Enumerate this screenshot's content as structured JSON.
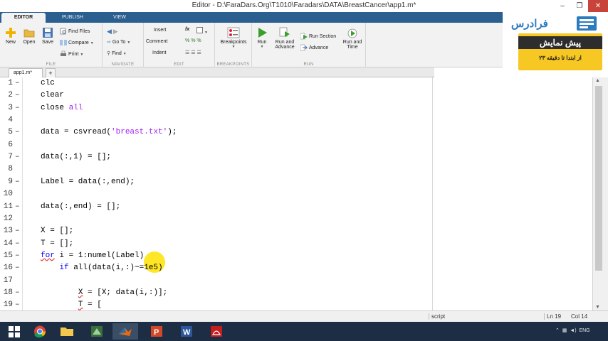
{
  "window": {
    "title": "Editor - D:\\FaraDars.Org\\T1010\\Faradars\\DATA\\BreastCancer\\app1.m*",
    "min": "–",
    "max": "❐",
    "close": "✕"
  },
  "tabs": [
    {
      "label": "EDITOR",
      "active": true
    },
    {
      "label": "PUBLISH",
      "active": false
    },
    {
      "label": "VIEW",
      "active": false
    }
  ],
  "ribbon": {
    "file": {
      "group": "FILE",
      "new": "New",
      "open": "Open",
      "save": "Save",
      "find_files": "Find Files",
      "compare": "Compare",
      "print": "Print"
    },
    "navigate": {
      "group": "NAVIGATE",
      "go_to": "Go To",
      "find": "Find"
    },
    "edit": {
      "group": "EDIT",
      "insert": "Insert",
      "fx": "fx",
      "comment": "Comment",
      "indent": "Indent"
    },
    "breakpoints": {
      "group": "BREAKPOINTS",
      "breakpoints": "Breakpoints"
    },
    "run": {
      "group": "RUN",
      "run": "Run",
      "run_and_advance": "Run and Advance",
      "run_section": "Run Section",
      "advance": "Advance",
      "run_and_time": "Run and Time"
    }
  },
  "ad": {
    "logo_text": "فرادرس",
    "line1": "پیش نمایش",
    "line2": "از ابتدا تا دقیقه ۲۳"
  },
  "file_tab": {
    "name": "app1.m*",
    "add": "+"
  },
  "code_lines": [
    {
      "n": "1",
      "text": "clc"
    },
    {
      "n": "2",
      "text": "clear"
    },
    {
      "n": "3",
      "text": "close all"
    },
    {
      "n": "4",
      "text": ""
    },
    {
      "n": "5",
      "text": "data = csvread('breast.txt');"
    },
    {
      "n": "6",
      "text": ""
    },
    {
      "n": "7",
      "text": "data(:,1) = [];"
    },
    {
      "n": "8",
      "text": ""
    },
    {
      "n": "9",
      "text": "Label = data(:,end);"
    },
    {
      "n": "10",
      "text": ""
    },
    {
      "n": "11",
      "text": "data(:,end) = [];"
    },
    {
      "n": "12",
      "text": ""
    },
    {
      "n": "13",
      "text": "X = [];"
    },
    {
      "n": "14",
      "text": "T = [];"
    },
    {
      "n": "15",
      "text": "for i = 1:numel(Label)"
    },
    {
      "n": "16",
      "text": "    if all(data(i,:)~=1e5)"
    },
    {
      "n": "17",
      "text": ""
    },
    {
      "n": "18",
      "text": "        X = [X; data(i,:)];"
    },
    {
      "n": "19",
      "text": "        T = ["
    }
  ],
  "status": {
    "type": "script",
    "ln_label": "Ln",
    "ln": "19",
    "col_label": "Col",
    "col": "14"
  },
  "taskbar": {
    "lang": "ENG"
  },
  "colors": {
    "tab_bar": "#2b5f8f",
    "keyword": "#0000ff",
    "string": "#a020f0",
    "ad_yellow": "#f7c823",
    "taskbar": "#1c2d44"
  }
}
